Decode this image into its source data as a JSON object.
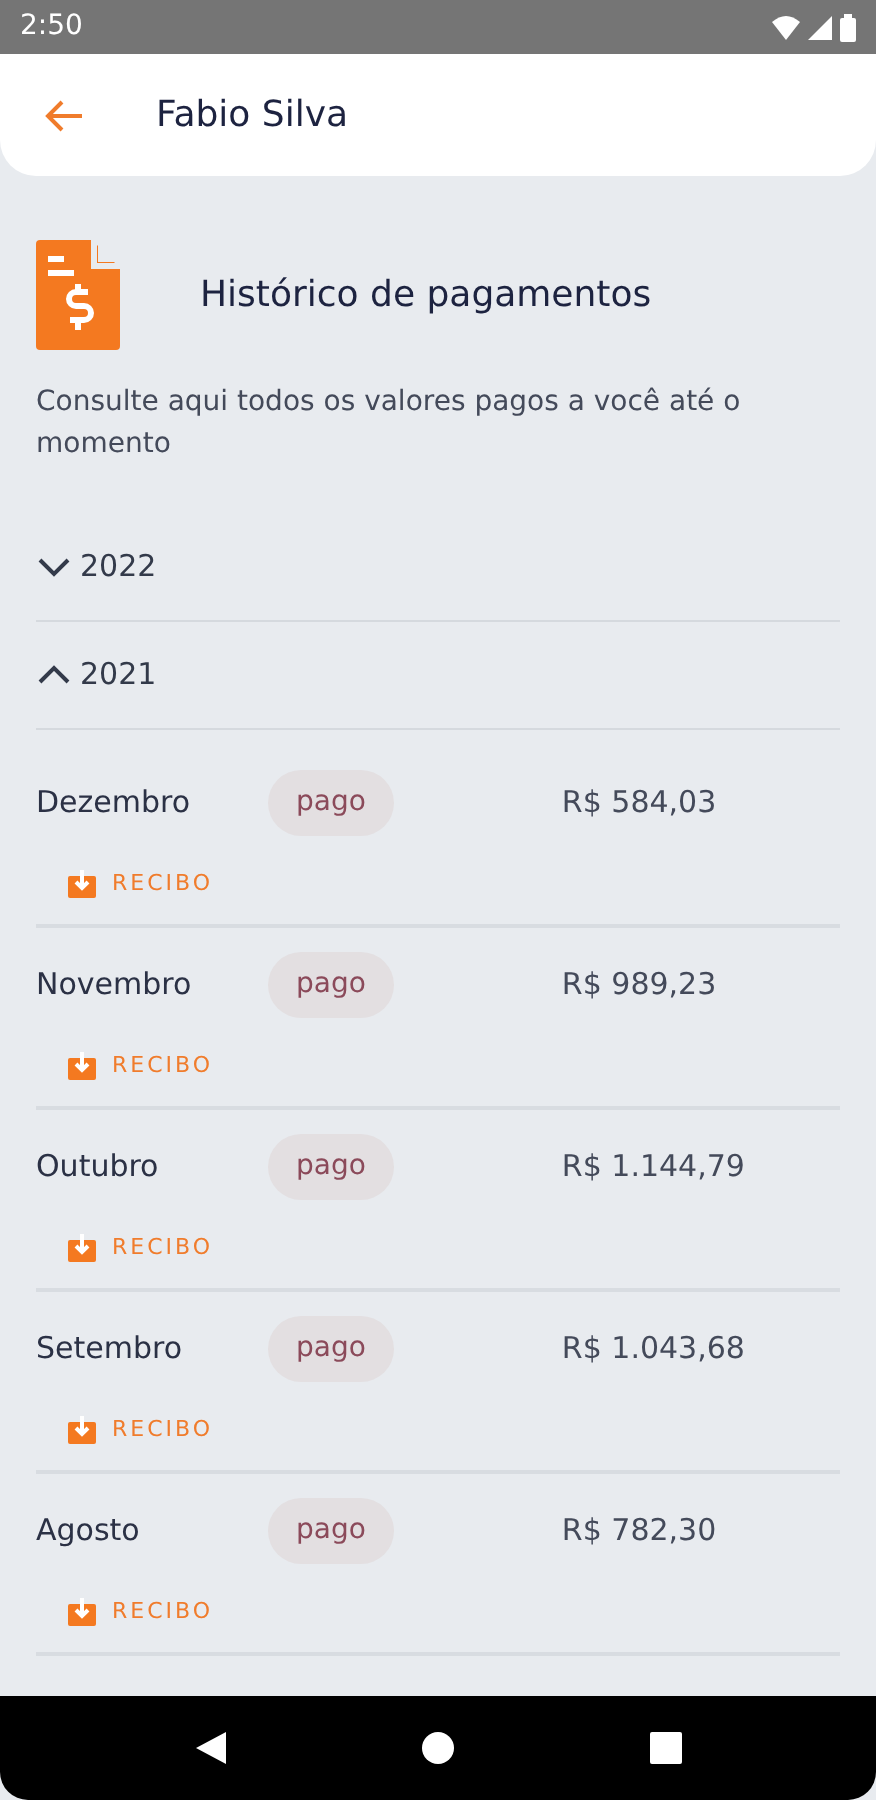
{
  "status_bar": {
    "time": "2:50"
  },
  "app_bar": {
    "title": "Fabio Silva"
  },
  "header": {
    "title": "Histórico de pagamentos",
    "description": "Consulte aqui todos os valores pagos a você até o momento"
  },
  "years": [
    {
      "label": "2022",
      "expanded": false
    },
    {
      "label": "2021",
      "expanded": true,
      "payments": [
        {
          "month": "Dezembro",
          "status": "pago",
          "amount": "R$ 584,03",
          "receipt": "RECIBO"
        },
        {
          "month": "Novembro",
          "status": "pago",
          "amount": "R$ 989,23",
          "receipt": "RECIBO"
        },
        {
          "month": "Outubro",
          "status": "pago",
          "amount": "R$ 1.144,79",
          "receipt": "RECIBO"
        },
        {
          "month": "Setembro",
          "status": "pago",
          "amount": "R$ 1.043,68",
          "receipt": "RECIBO"
        },
        {
          "month": "Agosto",
          "status": "pago",
          "amount": "R$ 782,30",
          "receipt": "RECIBO"
        }
      ]
    }
  ]
}
